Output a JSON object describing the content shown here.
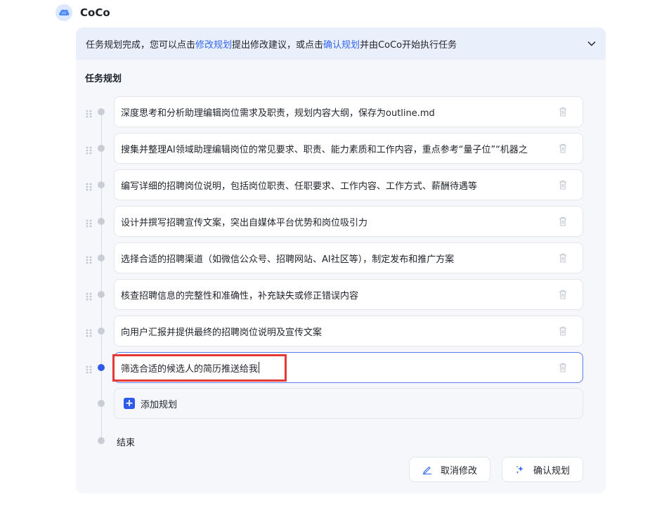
{
  "app": {
    "title": "CoCo"
  },
  "banner": {
    "text_1": "任务规划完成，您可以点击",
    "link_edit": "修改规划",
    "text_2": "提出修改建议，或点击",
    "link_confirm": "确认规划",
    "text_3": "并由CoCo开始执行任务"
  },
  "plan": {
    "title": "任务规划",
    "steps": [
      {
        "text": "深度思考和分析助理编辑岗位需求及职责，规划内容大纲，保存为outline.md"
      },
      {
        "text": "搜集并整理AI领域助理编辑岗位的常见要求、职责、能力素质和工作内容，重点参考“量子位”“机器之"
      },
      {
        "text": "编写详细的招聘岗位说明，包括岗位职责、任职要求、工作内容、工作方式、薪酬待遇等"
      },
      {
        "text": "设计并撰写招聘宣传文案，突出自媒体平台优势和岗位吸引力"
      },
      {
        "text": "选择合适的招聘渠道（如微信公众号、招聘网站、AI社区等），制定发布和推广方案"
      },
      {
        "text": "核查招聘信息的完整性和准确性，补充缺失或修正错误内容"
      },
      {
        "text": "向用户汇报并提供最终的招聘岗位说明及宣传文案"
      },
      {
        "text": "筛选合适的候选人的简历推送给我"
      }
    ],
    "add_label": "添加规划",
    "end_label": "结束"
  },
  "actions": {
    "cancel_label": "取消修改",
    "confirm_label": "确认规划"
  },
  "colors": {
    "accent": "#2f5bea",
    "link": "#3366ee",
    "highlight": "#e53935"
  }
}
